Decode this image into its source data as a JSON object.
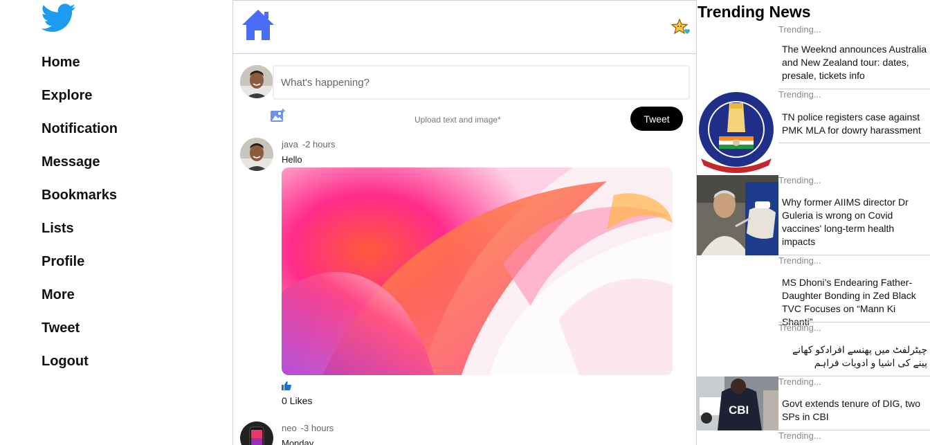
{
  "sidebar": {
    "logo_icon": "twitter-bird-icon",
    "nav": [
      "Home",
      "Explore",
      "Notification",
      "Message",
      "Bookmarks",
      "Lists",
      "Profile",
      "More",
      "Tweet",
      "Logout"
    ]
  },
  "feed": {
    "header_icon": "home-icon",
    "header_action_icon": "sparkle-star-icon",
    "composer": {
      "placeholder": "What's happening?",
      "upload_hint": "Upload text and image*",
      "tweet_label": "Tweet"
    },
    "posts": [
      {
        "user": "java",
        "time": "-2 hours",
        "text": "Hello",
        "has_image": true,
        "likes": "0 Likes"
      },
      {
        "user": "neo",
        "time": "-3 hours",
        "text": "Monday"
      }
    ]
  },
  "trending": {
    "title": "Trending News",
    "items": [
      {
        "label": "Trending...",
        "headline": "The Weeknd announces Australia and New Zealand tour: dates, presale, tickets info",
        "thumb": "none"
      },
      {
        "label": "Trending...",
        "headline": "TN police registers case against PMK MLA for dowry harassment",
        "thumb": "tamilnadu-police-emblem"
      },
      {
        "label": "Trending...",
        "headline": "Why former AIIMS director Dr Guleria is wrong on Covid vaccines' long-term health impacts",
        "thumb": "vaccination-photo"
      },
      {
        "label": "Trending...",
        "headline": "MS Dhoni’s Endearing Father-Daughter Bonding in Zed Black TVC Focuses on “Mann Ki Shanti”",
        "thumb": "none"
      },
      {
        "label": "Trending...",
        "headline": "چیٹرلفٹ میں پھنسے افرادکو کھانے پینے کی اشیا و ادویات فراہم",
        "thumb": "none",
        "rtl": true
      },
      {
        "label": "Trending...",
        "headline": "Govt extends tenure of DIG, two SPs in CBI",
        "thumb": "cbi-officer-photo"
      },
      {
        "label": "Trending..."
      }
    ]
  },
  "colors": {
    "tweet_button": "#000000",
    "twitter_blue": "#1d9bf0",
    "home_icon": "#4a6cf7",
    "like_icon": "#1a6ed8"
  }
}
